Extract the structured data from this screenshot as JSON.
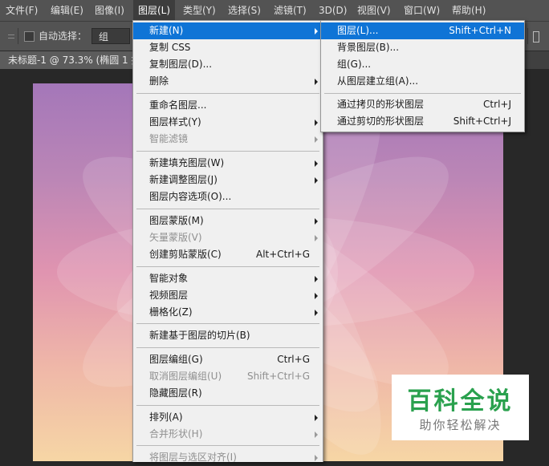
{
  "menubar": {
    "items": [
      {
        "label": "文件(F)"
      },
      {
        "label": "编辑(E)"
      },
      {
        "label": "图像(I)"
      },
      {
        "label": "图层(L)"
      },
      {
        "label": "类型(Y)"
      },
      {
        "label": "选择(S)"
      },
      {
        "label": "滤镜(T)"
      },
      {
        "label": "3D(D)"
      },
      {
        "label": "视图(V)"
      },
      {
        "label": "窗口(W)"
      },
      {
        "label": "帮助(H)"
      }
    ]
  },
  "options": {
    "auto_select_label": "自动选择：",
    "auto_select_value": "组",
    "auto_select_checked": false
  },
  "document": {
    "tab_title": "未标题-1 @ 73.3% (椭圆 1 拷"
  },
  "layer_menu": {
    "items": [
      {
        "label": "新建(N)",
        "shortcut": "",
        "submenu": true,
        "disabled": false,
        "highlighted": true
      },
      {
        "label": "复制 CSS",
        "shortcut": "",
        "submenu": false,
        "disabled": false,
        "highlighted": false
      },
      {
        "label": "复制图层(D)...",
        "shortcut": "",
        "submenu": false,
        "disabled": false,
        "highlighted": false
      },
      {
        "label": "删除",
        "shortcut": "",
        "submenu": true,
        "disabled": false,
        "highlighted": false
      },
      {
        "label": "重命名图层...",
        "shortcut": "",
        "submenu": false,
        "disabled": false,
        "highlighted": false
      },
      {
        "label": "图层样式(Y)",
        "shortcut": "",
        "submenu": true,
        "disabled": false,
        "highlighted": false
      },
      {
        "label": "智能滤镜",
        "shortcut": "",
        "submenu": true,
        "disabled": true,
        "highlighted": false
      },
      {
        "label": "新建填充图层(W)",
        "shortcut": "",
        "submenu": true,
        "disabled": false,
        "highlighted": false
      },
      {
        "label": "新建调整图层(J)",
        "shortcut": "",
        "submenu": true,
        "disabled": false,
        "highlighted": false
      },
      {
        "label": "图层内容选项(O)...",
        "shortcut": "",
        "submenu": false,
        "disabled": false,
        "highlighted": false
      },
      {
        "label": "图层蒙版(M)",
        "shortcut": "",
        "submenu": true,
        "disabled": false,
        "highlighted": false
      },
      {
        "label": "矢量蒙版(V)",
        "shortcut": "",
        "submenu": true,
        "disabled": true,
        "highlighted": false
      },
      {
        "label": "创建剪贴蒙版(C)",
        "shortcut": "Alt+Ctrl+G",
        "submenu": false,
        "disabled": false,
        "highlighted": false
      },
      {
        "label": "智能对象",
        "shortcut": "",
        "submenu": true,
        "disabled": false,
        "highlighted": false
      },
      {
        "label": "视频图层",
        "shortcut": "",
        "submenu": true,
        "disabled": false,
        "highlighted": false
      },
      {
        "label": "栅格化(Z)",
        "shortcut": "",
        "submenu": true,
        "disabled": false,
        "highlighted": false
      },
      {
        "label": "新建基于图层的切片(B)",
        "shortcut": "",
        "submenu": false,
        "disabled": false,
        "highlighted": false
      },
      {
        "label": "图层编组(G)",
        "shortcut": "Ctrl+G",
        "submenu": false,
        "disabled": false,
        "highlighted": false
      },
      {
        "label": "取消图层编组(U)",
        "shortcut": "Shift+Ctrl+G",
        "submenu": false,
        "disabled": true,
        "highlighted": false
      },
      {
        "label": "隐藏图层(R)",
        "shortcut": "",
        "submenu": false,
        "disabled": false,
        "highlighted": false
      },
      {
        "label": "排列(A)",
        "shortcut": "",
        "submenu": true,
        "disabled": false,
        "highlighted": false
      },
      {
        "label": "合并形状(H)",
        "shortcut": "",
        "submenu": true,
        "disabled": true,
        "highlighted": false
      },
      {
        "label": "将图层与选区对齐(I)",
        "shortcut": "",
        "submenu": true,
        "disabled": true,
        "highlighted": false
      }
    ]
  },
  "new_submenu": {
    "items": [
      {
        "label": "图层(L)...",
        "shortcut": "Shift+Ctrl+N",
        "disabled": false,
        "highlighted": true
      },
      {
        "label": "背景图层(B)...",
        "shortcut": "",
        "disabled": false,
        "highlighted": false
      },
      {
        "label": "组(G)...",
        "shortcut": "",
        "disabled": false,
        "highlighted": false
      },
      {
        "label": "从图层建立组(A)...",
        "shortcut": "",
        "disabled": false,
        "highlighted": false
      },
      {
        "label": "通过拷贝的形状图层",
        "shortcut": "Ctrl+J",
        "disabled": false,
        "highlighted": false
      },
      {
        "label": "通过剪切的形状图层",
        "shortcut": "Shift+Ctrl+J",
        "disabled": false,
        "highlighted": false
      }
    ]
  },
  "watermark": {
    "title": "百科全说",
    "subtitle": "助你轻松解决"
  }
}
